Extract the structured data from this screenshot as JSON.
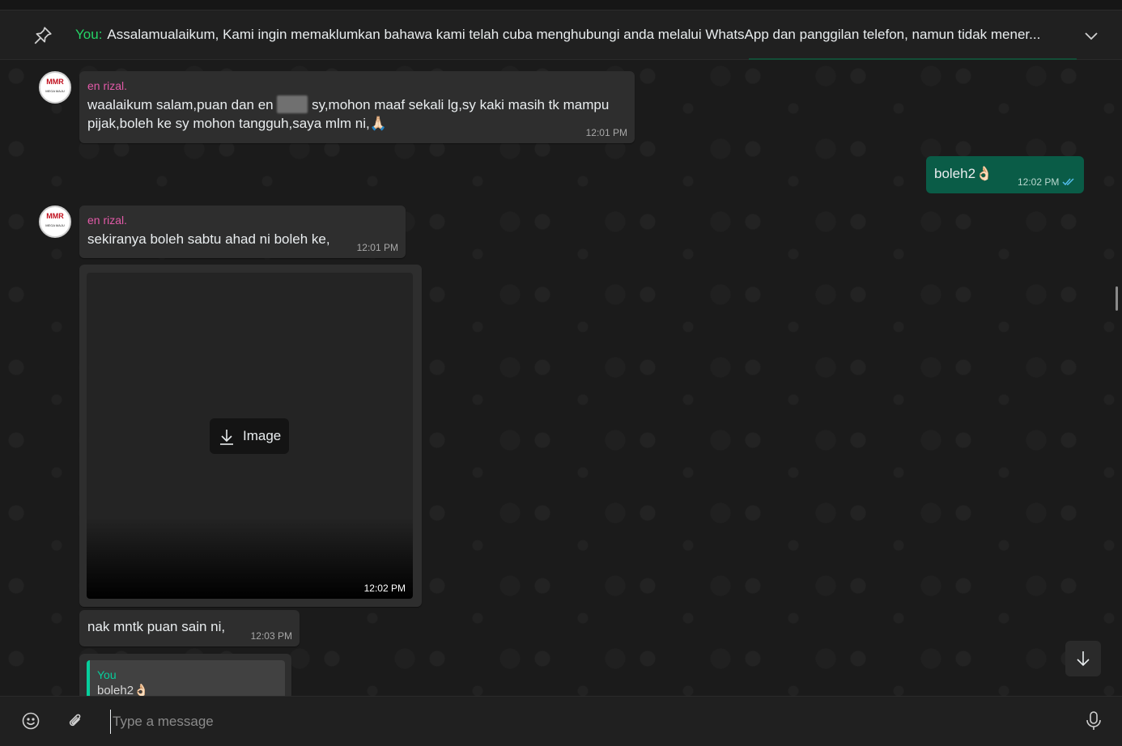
{
  "pinned": {
    "sender": "You:",
    "text": "Assalamualaikum,  Kami ingin memaklumkan bahawa kami telah cuba menghubungi anda melalui WhatsApp dan panggilan telefon, namun tidak mener..."
  },
  "avatar": {
    "logo": "MMR",
    "subtitle": "MEGA MAJU"
  },
  "messages": [
    {
      "sender": "en rizal.",
      "text_part1": "waalaikum salam,puan dan en ",
      "text_part2": " sy,mohon maaf sekali lg,sy kaki masih tk mampu",
      "text_line2": "pijak,boleh ke sy mohon tangguh,saya mlm ni,🙏🏻",
      "time": "12:01 PM"
    },
    {
      "text": "boleh2👌🏻",
      "time": "12:02 PM",
      "status": "read"
    },
    {
      "sender": "en rizal.",
      "text": "sekiranya boleh sabtu ahad ni boleh ke,",
      "time": "12:01 PM"
    },
    {
      "media_label": "Image",
      "time": "12:02 PM"
    },
    {
      "text": "nak mntk puan sain ni,",
      "time": "12:03 PM"
    },
    {
      "quote_name": "You",
      "quote_text": "boleh2👌🏻"
    }
  ],
  "composer": {
    "placeholder": "Type a message"
  },
  "colors": {
    "outgoing": "#0a5c47",
    "incoming": "#2e2e2e",
    "sender_name": "#e25aa8",
    "accent": "#06cf9c"
  }
}
